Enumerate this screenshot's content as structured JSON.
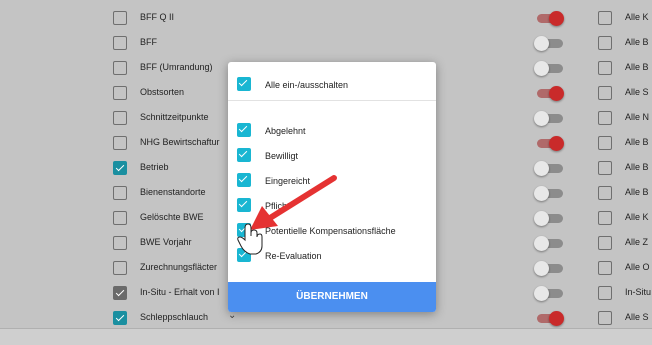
{
  "layers": [
    {
      "label": "BFF Q II",
      "checked": false,
      "toggle": "on",
      "right": "Alle K"
    },
    {
      "label": "BFF",
      "checked": false,
      "toggle": "off",
      "right": "Alle B"
    },
    {
      "label": "BFF (Umrandung)",
      "checked": false,
      "toggle": "off",
      "right": "Alle B"
    },
    {
      "label": "Obstsorten",
      "checked": false,
      "toggle": "on",
      "right": "Alle S"
    },
    {
      "label": "Schnittzeitpunkte",
      "checked": false,
      "toggle": "off",
      "right": "Alle N"
    },
    {
      "label": "NHG Bewirtschaftur",
      "checked": false,
      "toggle": "on",
      "right": "Alle B"
    },
    {
      "label": "Betrieb",
      "checked": true,
      "toggle": "off",
      "right": "Alle B"
    },
    {
      "label": "Bienenstandorte",
      "checked": false,
      "toggle": "off",
      "right": "Alle B"
    },
    {
      "label": "Gelöschte BWE",
      "checked": false,
      "toggle": "off",
      "right": "Alle K"
    },
    {
      "label": "BWE Vorjahr",
      "checked": false,
      "toggle": "off",
      "right": "Alle Z"
    },
    {
      "label": "Zurechnungsfläcter",
      "checked": false,
      "toggle": "off",
      "right": "Alle O"
    },
    {
      "label": "In-Situ - Erhalt von I",
      "checked": true,
      "dark": true,
      "toggle": "off",
      "right": "In-Situ"
    },
    {
      "label": "Schleppschlauch",
      "checked": true,
      "toggle": "on",
      "right": "Alle S"
    }
  ],
  "popup": {
    "toggle_all_label": "Alle ein-/ausschalten",
    "options": [
      "Abgelehnt",
      "Bewilligt",
      "Eingereicht",
      "Pflicht",
      "Potentielle Kompensationsfläche",
      "Re-Evaluation"
    ],
    "apply_label": "ÜBERNEHMEN"
  },
  "chevron": "⌄",
  "colors": {
    "checkbox": "#1a8fa0",
    "popup_checkbox": "#19b6d2",
    "toggle_on": "#c92a2a",
    "apply_button": "#4b8ff0",
    "arrow": "#e53232"
  }
}
